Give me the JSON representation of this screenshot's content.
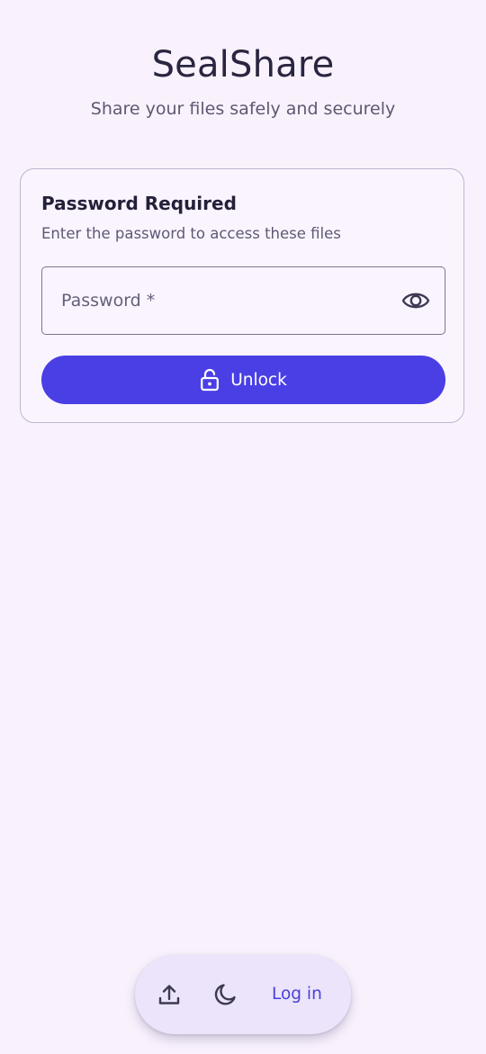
{
  "header": {
    "title": "SealShare",
    "subtitle": "Share your files safely and securely"
  },
  "card": {
    "title": "Password Required",
    "description": "Enter the password to access these files",
    "password": {
      "value": "",
      "placeholder": "Password *",
      "visibility_icon": "eye-icon"
    },
    "unlock_button": {
      "label": "Unlock",
      "icon": "lock-open-icon"
    }
  },
  "bottom_bar": {
    "upload_icon": "upload-icon",
    "theme_icon": "moon-icon",
    "login_label": "Log in"
  },
  "colors": {
    "background": "#f9f2fd",
    "primary": "#4a3fe4",
    "card_border": "#bdb6cf",
    "bottom_bar": "#ebe4fb",
    "link": "#4a3fd9"
  }
}
